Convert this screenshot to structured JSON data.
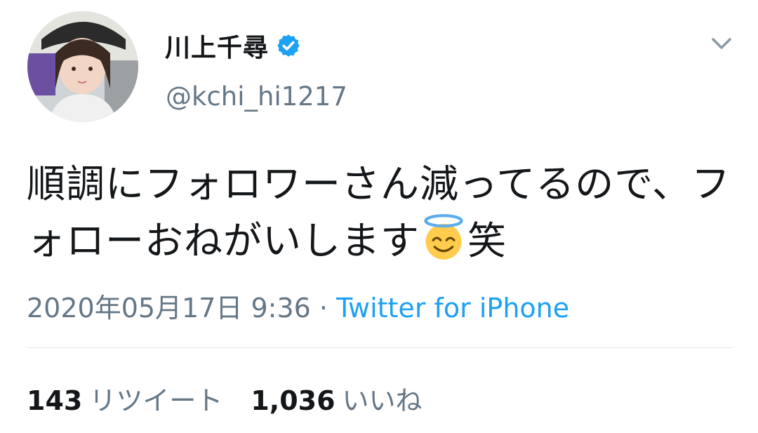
{
  "user": {
    "display_name": "川上千尋",
    "handle": "@kchi_hi1217",
    "verified": true
  },
  "tweet": {
    "text_before_emoji": "順調にフォロワーさん減ってるので、フォローおねがいします",
    "emoji": "smiling-face-with-halo",
    "text_after_emoji": "笑",
    "timestamp": "2020年05月17日 9:36",
    "separator": " · ",
    "source": "Twitter for iPhone"
  },
  "stats": {
    "retweets_count": "143",
    "retweets_label": "リツイート",
    "likes_count": "1,036",
    "likes_label": "いいね"
  },
  "colors": {
    "text": "#14171a",
    "secondary": "#657786",
    "link": "#1da1f2",
    "divider": "#e1e8ed"
  },
  "icons": {
    "verified": "verified-badge-icon",
    "caret": "chevron-down-icon"
  }
}
